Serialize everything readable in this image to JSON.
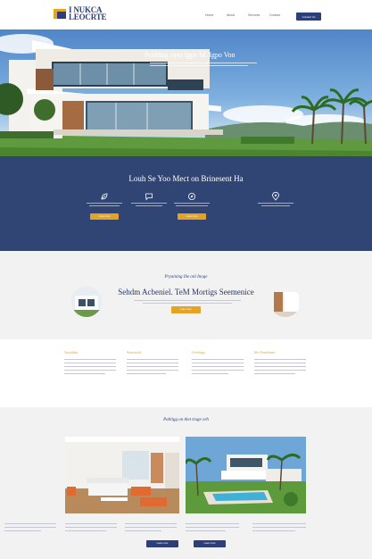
{
  "header": {
    "logo_line1": "I NUKCA",
    "logo_line2": "LEOCRTE",
    "nav": [
      "Home",
      "About",
      "Services",
      "Contact"
    ],
    "cta_label": "Contact Us"
  },
  "hero": {
    "title": "Poiddng oyer Igpe M. Igpo Von"
  },
  "features": {
    "title": "Louh Se Yoo Mect on Brinesent Ha",
    "items": [
      {
        "icon": "leaf-icon",
        "button": "Learn more"
      },
      {
        "icon": "chat-icon",
        "button": ""
      },
      {
        "icon": "compass-icon",
        "button": "Learn more"
      },
      {
        "icon": "location-pin-icon",
        "button": ""
      }
    ]
  },
  "intro": {
    "eyebrow": "Pryaining Ihe onl Inoge",
    "title": "Sehdm Acbeniel. TeM Mortigs Seemenice",
    "button": "Learn more"
  },
  "columns": [
    {
      "heading": "Aucoldan"
    },
    {
      "heading": "Acaiviosls"
    },
    {
      "heading": "Grriiinge"
    },
    {
      "heading": "Ihe Prnielnase"
    }
  ],
  "gallery": {
    "title": "Pabligg on thet trage orh",
    "card_buttons": [
      "Learn more",
      "Learn more"
    ]
  },
  "colors": {
    "navy": "#314575",
    "accent": "#e6a321"
  }
}
